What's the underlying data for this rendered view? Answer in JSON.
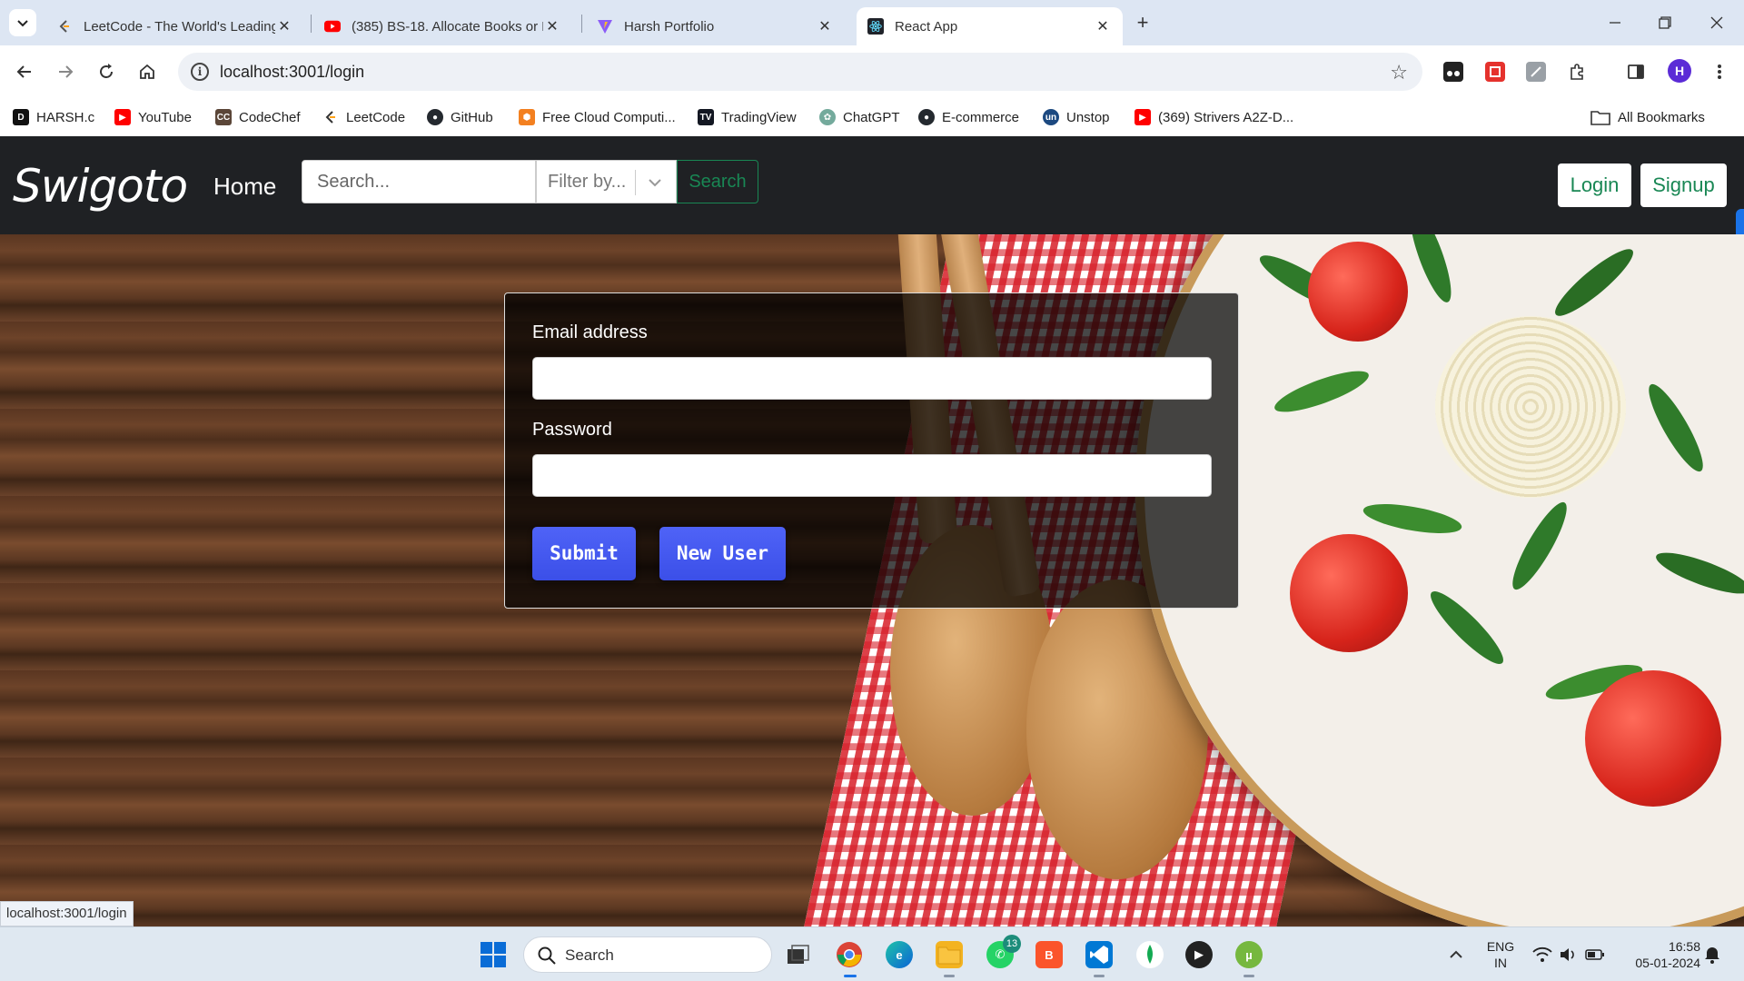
{
  "browser": {
    "tabs": [
      {
        "title": "LeetCode - The World's Leading",
        "icon": "leetcode-icon"
      },
      {
        "title": "(385) BS-18. Allocate Books or B",
        "icon": "youtube-icon"
      },
      {
        "title": "Harsh Portfolio",
        "icon": "vite-icon"
      },
      {
        "title": "React App",
        "icon": "react-icon"
      }
    ],
    "url": "localhost:3001/login",
    "profile_initial": "H",
    "bookmarks": [
      {
        "label": "HARSH.c",
        "icon": "harsh-icon",
        "color": "#111111"
      },
      {
        "label": "YouTube",
        "icon": "youtube-icon",
        "color": "#ff0000"
      },
      {
        "label": "CodeChef",
        "icon": "codechef-icon",
        "color": "#5b4638"
      },
      {
        "label": "LeetCode",
        "icon": "leetcode-icon",
        "color": "#ffa116"
      },
      {
        "label": "GitHub",
        "icon": "github-icon",
        "color": "#24292f"
      },
      {
        "label": "Free Cloud Computi...",
        "icon": "cloud-icon",
        "color": "#f38020"
      },
      {
        "label": "TradingView",
        "icon": "tradingview-icon",
        "color": "#131722"
      },
      {
        "label": "ChatGPT",
        "icon": "chatgpt-icon",
        "color": "#74aa9c"
      },
      {
        "label": "E-commerce",
        "icon": "github-icon",
        "color": "#24292f"
      },
      {
        "label": "Unstop",
        "icon": "unstop-icon",
        "color": "#1c4980"
      },
      {
        "label": "(369) Strivers A2Z-D...",
        "icon": "youtube-icon",
        "color": "#ff0000"
      }
    ],
    "all_bookmarks": "All Bookmarks",
    "status_url": "localhost:3001/login"
  },
  "app": {
    "brand": "Swigoto",
    "nav_home": "Home",
    "search_placeholder": "Search...",
    "filter_placeholder": "Filter by...",
    "search_button": "Search",
    "login_button": "Login",
    "signup_button": "Signup",
    "accent_color": "#198754"
  },
  "form": {
    "email_label": "Email address",
    "email_value": "",
    "password_label": "Password",
    "password_value": "",
    "submit_label": "Submit",
    "new_user_label": "New User",
    "button_color": "#3b4fe8"
  },
  "taskbar": {
    "search_label": "Search",
    "whatsapp_badge": "13",
    "lang_top": "ENG",
    "lang_bottom": "IN",
    "time": "16:58",
    "date": "05-01-2024"
  }
}
